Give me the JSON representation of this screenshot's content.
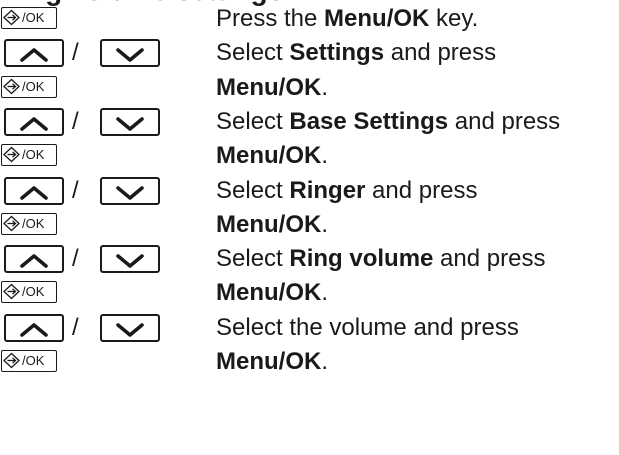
{
  "heading": "Ring volume settings",
  "keys": {
    "menu_key_label": "/OK",
    "separator": "/"
  },
  "steps": [
    {
      "key": "menu",
      "parts": [
        {
          "t": "Press the ",
          "b": false
        },
        {
          "t": "Menu/OK",
          "b": true
        },
        {
          "t": " key.",
          "b": false
        }
      ]
    },
    {
      "key": "nav",
      "parts": [
        {
          "t": "Select ",
          "b": false
        },
        {
          "t": "Settings",
          "b": true
        },
        {
          "t": " and press",
          "b": false
        }
      ]
    },
    {
      "key": "menu",
      "parts": [
        {
          "t": "Menu/OK",
          "b": true
        },
        {
          "t": ".",
          "b": false
        }
      ]
    },
    {
      "key": "nav",
      "parts": [
        {
          "t": "Select ",
          "b": false
        },
        {
          "t": "Base Settings",
          "b": true
        },
        {
          "t": " and press",
          "b": false
        }
      ]
    },
    {
      "key": "menu",
      "parts": [
        {
          "t": "Menu/OK",
          "b": true
        },
        {
          "t": ".",
          "b": false
        }
      ]
    },
    {
      "key": "nav",
      "parts": [
        {
          "t": "Select ",
          "b": false
        },
        {
          "t": "Ringer",
          "b": true
        },
        {
          "t": " and press",
          "b": false
        }
      ]
    },
    {
      "key": "menu",
      "parts": [
        {
          "t": "Menu/OK",
          "b": true
        },
        {
          "t": ".",
          "b": false
        }
      ]
    },
    {
      "key": "nav",
      "parts": [
        {
          "t": "Select ",
          "b": false
        },
        {
          "t": "Ring volume",
          "b": true
        },
        {
          "t": " and press",
          "b": false
        }
      ]
    },
    {
      "key": "menu",
      "parts": [
        {
          "t": "Menu/OK",
          "b": true
        },
        {
          "t": ".",
          "b": false
        }
      ]
    },
    {
      "key": "nav",
      "parts": [
        {
          "t": "Select the volume and press",
          "b": false
        }
      ]
    },
    {
      "key": "menu",
      "parts": [
        {
          "t": "Menu/OK",
          "b": true
        },
        {
          "t": ".",
          "b": false
        }
      ]
    }
  ]
}
